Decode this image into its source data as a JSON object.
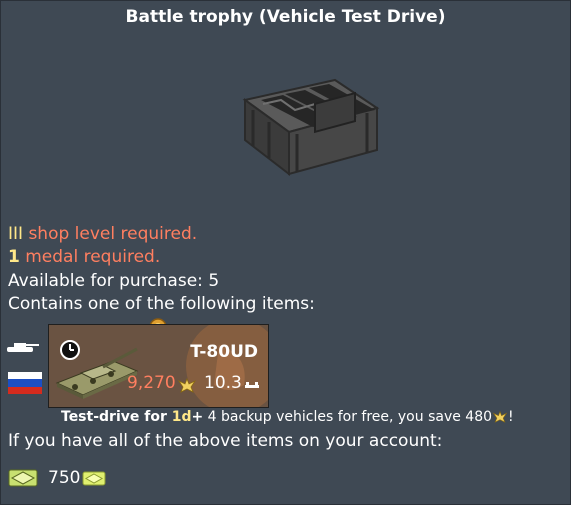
{
  "title": "Battle trophy (Vehicle Test Drive)",
  "requirements": {
    "shop_level_num": "III",
    "shop_level_text": "shop level required.",
    "medal_num": "1",
    "medal_text": "medal required."
  },
  "purchase": {
    "label": "Available for purchase: ",
    "count": "5"
  },
  "contains_text": "Contains one of the following items:",
  "vehicle": {
    "name": "T-80UD",
    "rp_cost": "9,270",
    "battle_rating": "10.3",
    "nation": "USSR",
    "icons": [
      "clock-icon",
      "tank-silhouette-icon",
      "russia-flag-icon",
      "research-points-icon",
      "ground-vehicle-icon",
      "rank-medal-icon"
    ]
  },
  "test_drive": {
    "prefix": "Test-drive for ",
    "duration": "1d",
    "plus": "+",
    "middle": " 4 backup vehicles for free, you save 480",
    "suffix": "!"
  },
  "owned_text": "If you have all of the above items on your account:",
  "price": {
    "amount": "750",
    "currency_icon": "warbond-coupon-icon"
  },
  "colors": {
    "background": "#3f4954",
    "requirement_red": "#ff7f60",
    "highlight_yellow": "#ffe889",
    "card_bg": "#6a5342"
  }
}
